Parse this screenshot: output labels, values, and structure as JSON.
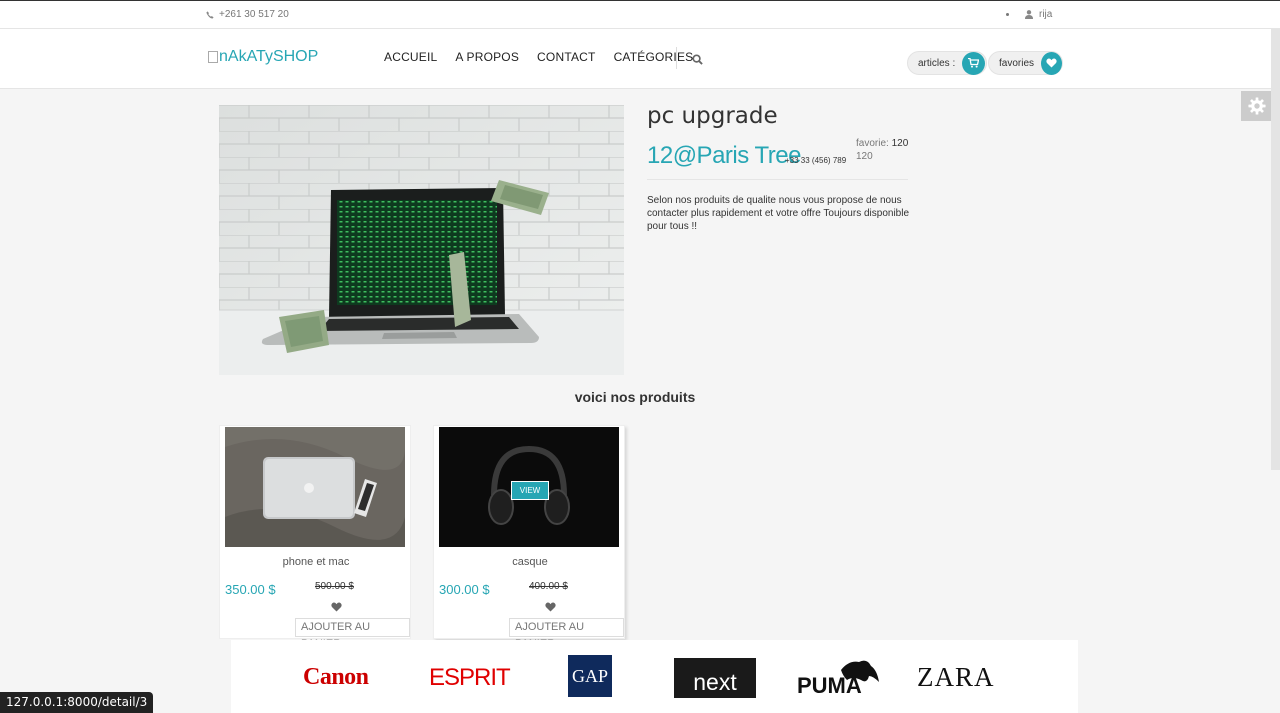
{
  "topbar": {
    "phone": "+261 30 517 20",
    "user": "rija"
  },
  "header": {
    "logo_alt": "nAkATySHOP",
    "nav": [
      "ACCUEIL",
      "A PROPOS",
      "CONTACT",
      "CATÉGORIES"
    ],
    "articles_label": "articles :",
    "favories_label": "favories"
  },
  "product": {
    "title": "pc upgrade",
    "store": "12@Paris Tree",
    "store_phone": "+33 33 (456) 789",
    "favorie_label": "favorie:",
    "favorie_value": "120",
    "favorie_sub": "120",
    "description": "Selon nos produits de qualite nous vous propose de nous contacter plus rapidement et votre offre Toujours disponible pour tous !!"
  },
  "section_heading": "voici nos produits",
  "products": [
    {
      "name": "phone et mac",
      "price": "350.00 $",
      "old_price": "500.00 $",
      "cart_label": "AJOUTER AU PANIER"
    },
    {
      "name": "casque",
      "price": "300.00 $",
      "old_price": "400.00 $",
      "cart_label": "AJOUTER AU PANIER",
      "view_label": "VIEW"
    }
  ],
  "brands": [
    "Canon",
    "ESPRIT",
    "GAP",
    "next",
    "PUMA",
    "ZARA"
  ],
  "status_url": "127.0.0.1:8000/detail/3",
  "colors": {
    "accent": "#27a6b4",
    "background": "#f5f5f5"
  },
  "icons": [
    "phone-icon",
    "user-icon",
    "search-icon",
    "cart-icon",
    "heart-icon",
    "gear-icon"
  ]
}
